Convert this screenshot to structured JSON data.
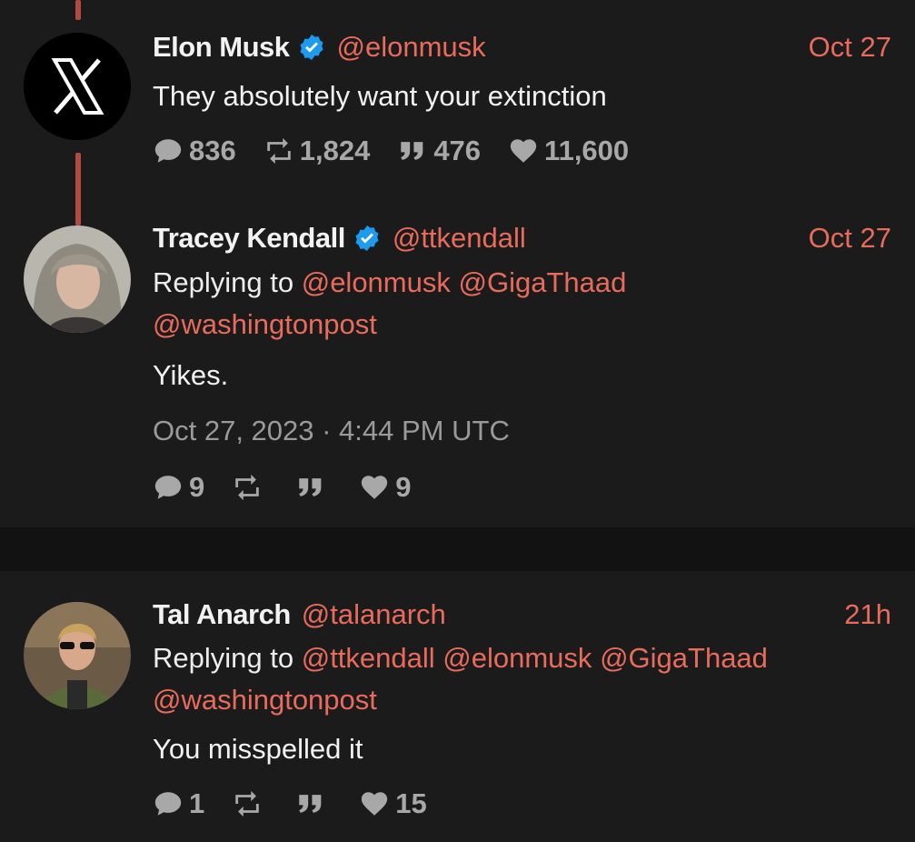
{
  "tweets": [
    {
      "name": "Elon Musk",
      "verified": true,
      "handle": "@elonmusk",
      "date": "Oct 27",
      "text": "They absolutely want your extinction",
      "stats": {
        "replies": "836",
        "retweets": "1,824",
        "quotes": "476",
        "likes": "11,600"
      }
    },
    {
      "name": "Tracey Kendall",
      "verified": true,
      "handle": "@ttkendall",
      "date": "Oct 27",
      "replying_prefix": "Replying to",
      "replying_to": [
        "@elonmusk",
        "@GigaThaad",
        "@washingtonpost"
      ],
      "text": "Yikes.",
      "timestamp": "Oct 27, 2023 · 4:44 PM UTC",
      "stats": {
        "replies": "9",
        "retweets": "",
        "quotes": "",
        "likes": "9"
      }
    },
    {
      "name": "Tal Anarch",
      "verified": false,
      "handle": "@talanarch",
      "date": "21h",
      "replying_prefix": "Replying to",
      "replying_to": [
        "@ttkendall",
        "@elonmusk",
        "@GigaThaad",
        "@washingtonpost"
      ],
      "text": "You misspelled it",
      "stats": {
        "replies": "1",
        "retweets": "",
        "quotes": "",
        "likes": "15"
      }
    }
  ],
  "icons": {
    "reply": "reply-icon",
    "retweet": "retweet-icon",
    "quote": "quote-icon",
    "like": "heart-icon",
    "verified": "verified-badge-icon"
  },
  "colors": {
    "accent": "#e86b5c",
    "verified": "#1d9bf0",
    "background": "#1b1b1b",
    "thread_line": "#b04a42"
  }
}
